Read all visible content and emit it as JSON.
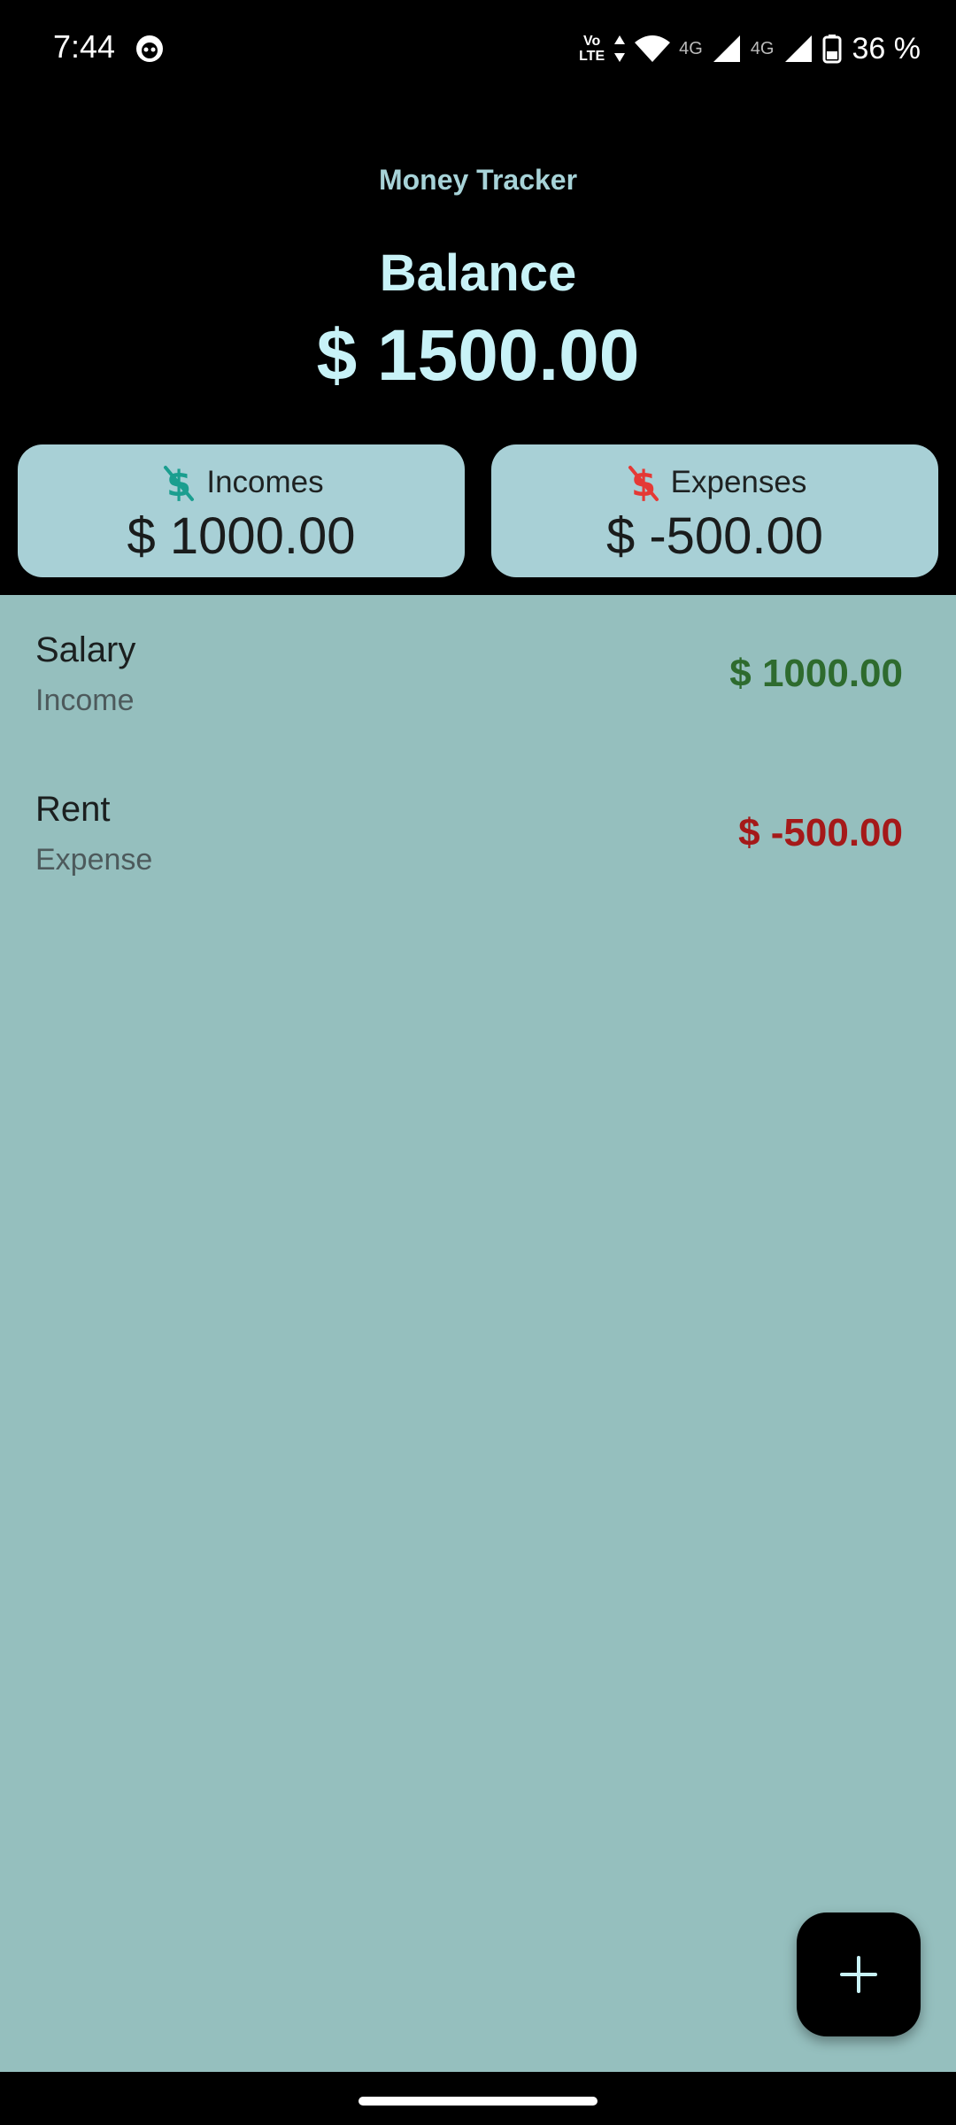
{
  "status_bar": {
    "time": "7:44",
    "volte_top": "Vo",
    "volte_bottom": "LTE",
    "network_1": "4G",
    "network_2": "4G",
    "battery": "36 %"
  },
  "header": {
    "app_title": "Money Tracker",
    "balance_label": "Balance",
    "balance_value": "$ 1500.00"
  },
  "summary": {
    "incomes": {
      "label": "Incomes",
      "value": "$ 1000.00",
      "icon": "dollar-icon",
      "icon_color": "#1a9e8f"
    },
    "expenses": {
      "label": "Expenses",
      "value": "$ -500.00",
      "icon": "dollar-icon",
      "icon_color": "#e53935"
    }
  },
  "transactions": [
    {
      "title": "Salary",
      "type": "Income",
      "amount": "$ 1000.00",
      "amount_color": "#2e6b2e"
    },
    {
      "title": "Rent",
      "type": "Expense",
      "amount": "$ -500.00",
      "amount_color": "#a51919"
    }
  ],
  "fab": {
    "icon": "plus-icon"
  },
  "colors": {
    "header_background": "#000000",
    "card_background": "#a8d0d6",
    "list_background": "#95bfbe",
    "balance_text": "#c8f2f7"
  }
}
